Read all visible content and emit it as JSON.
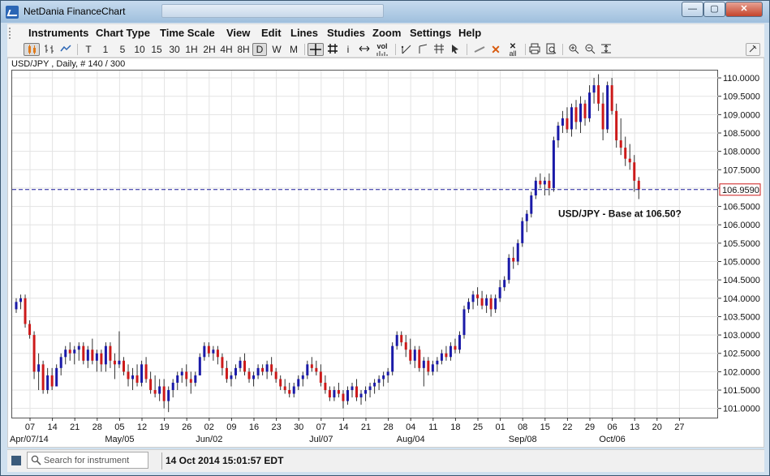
{
  "window": {
    "title": "NetDania FinanceChart",
    "title_search_value": "",
    "buttons": {
      "minimize": "—",
      "maximize": "▢",
      "close": "✕"
    }
  },
  "menu": {
    "items": [
      "Instruments",
      "Chart Type",
      "Time Scale",
      "View",
      "Edit",
      "Lines",
      "Studies",
      "Zoom",
      "Settings",
      "Help"
    ]
  },
  "toolbar": {
    "timeframes": [
      "T",
      "1",
      "5",
      "10",
      "15",
      "30",
      "1H",
      "2H",
      "4H",
      "8H",
      "D",
      "W",
      "M"
    ],
    "active_timeframe": "D",
    "info_label": "i",
    "volume_label": "vol",
    "clear_all_label": "all"
  },
  "chart": {
    "symbol_label": "USD/JPY , Daily, # 140 / 300",
    "annotation": "USD/JPY - Base at 106.50?",
    "current_price_label": "106.9590",
    "colors": {
      "up": "#1a1aa8",
      "down": "#cc1a1a",
      "price_line": "#1d1d9c",
      "price_box_border": "#cc1a1a",
      "grid": "#e3e3e3"
    }
  },
  "status": {
    "search_placeholder": "Search for instrument",
    "datetime": "14 Oct 2014 15:01:57 EDT"
  },
  "chart_data": {
    "type": "candlestick",
    "title": "USD/JPY , Daily, # 140 / 300",
    "ylim": [
      100.75,
      110.2
    ],
    "y_ticks": [
      101.0,
      101.5,
      102.0,
      102.5,
      103.0,
      103.5,
      104.0,
      104.5,
      105.0,
      105.5,
      106.0,
      106.5,
      107.0,
      107.5,
      108.0,
      108.5,
      109.0,
      109.5,
      110.0
    ],
    "y_tick_labels": [
      "101.0000",
      "101.5000",
      "102.0000",
      "102.5000",
      "103.0000",
      "103.5000",
      "104.0000",
      "104.5000",
      "105.0000",
      "105.5000",
      "106.0000",
      "106.5000",
      "107.0000",
      "107.5000",
      "108.0000",
      "108.5000",
      "109.0000",
      "109.5000",
      "110.0000"
    ],
    "x_tick_labels": [
      "07",
      "14",
      "21",
      "28",
      "05",
      "12",
      "19",
      "26",
      "02",
      "09",
      "16",
      "23",
      "30",
      "07",
      "14",
      "21",
      "28",
      "04",
      "11",
      "18",
      "25",
      "01",
      "08",
      "15",
      "22",
      "29",
      "06",
      "13",
      "20",
      "27"
    ],
    "month_labels": [
      {
        "label": "Apr/07/14",
        "index": 0
      },
      {
        "label": "May/05",
        "index": 4
      },
      {
        "label": "Jun/02",
        "index": 8
      },
      {
        "label": "Jul/07",
        "index": 13
      },
      {
        "label": "Aug/04",
        "index": 17
      },
      {
        "label": "Sep/08",
        "index": 22
      },
      {
        "label": "Oct/06",
        "index": 26
      }
    ],
    "current_price": 106.959,
    "grid": true,
    "candles": [
      [
        103.7,
        104.0,
        103.6,
        103.9
      ],
      [
        103.9,
        104.1,
        103.7,
        104.0
      ],
      [
        104.0,
        104.1,
        103.2,
        103.3
      ],
      [
        103.3,
        103.4,
        102.9,
        103.0
      ],
      [
        103.0,
        103.1,
        101.8,
        102.0
      ],
      [
        102.0,
        102.5,
        101.5,
        102.2
      ],
      [
        102.2,
        102.3,
        101.4,
        101.5
      ],
      [
        101.5,
        102.1,
        101.4,
        101.9
      ],
      [
        101.9,
        102.1,
        101.5,
        101.6
      ],
      [
        101.6,
        102.2,
        101.6,
        102.1
      ],
      [
        102.1,
        102.5,
        101.9,
        102.4
      ],
      [
        102.4,
        102.7,
        102.2,
        102.6
      ],
      [
        102.6,
        102.8,
        102.3,
        102.5
      ],
      [
        102.5,
        102.7,
        102.2,
        102.6
      ],
      [
        102.6,
        102.8,
        102.3,
        102.7
      ],
      [
        102.7,
        102.8,
        102.2,
        102.3
      ],
      [
        102.3,
        102.7,
        102.1,
        102.6
      ],
      [
        102.6,
        102.9,
        102.2,
        102.3
      ],
      [
        102.3,
        102.6,
        102.0,
        102.5
      ],
      [
        102.5,
        102.6,
        102.0,
        102.2
      ],
      [
        102.2,
        102.8,
        102.0,
        102.7
      ],
      [
        102.7,
        102.8,
        102.1,
        102.3
      ],
      [
        102.3,
        102.5,
        101.8,
        102.2
      ],
      [
        102.2,
        103.1,
        102.1,
        102.3
      ],
      [
        102.3,
        102.4,
        101.9,
        102.0
      ],
      [
        102.0,
        102.2,
        101.6,
        101.8
      ],
      [
        101.8,
        102.1,
        101.5,
        101.9
      ],
      [
        101.9,
        102.2,
        101.6,
        101.7
      ],
      [
        101.7,
        102.3,
        101.6,
        102.2
      ],
      [
        102.2,
        102.4,
        101.7,
        101.8
      ],
      [
        101.8,
        102.0,
        101.4,
        101.5
      ],
      [
        101.5,
        101.9,
        101.3,
        101.4
      ],
      [
        101.4,
        101.8,
        101.2,
        101.6
      ],
      [
        101.6,
        101.8,
        101.0,
        101.2
      ],
      [
        101.2,
        101.6,
        100.9,
        101.5
      ],
      [
        101.5,
        101.8,
        101.3,
        101.7
      ],
      [
        101.7,
        102.0,
        101.5,
        101.9
      ],
      [
        101.9,
        102.1,
        101.7,
        102.0
      ],
      [
        102.0,
        102.2,
        101.6,
        101.8
      ],
      [
        101.8,
        102.0,
        101.4,
        101.7
      ],
      [
        101.7,
        102.0,
        101.6,
        101.9
      ],
      [
        101.9,
        102.5,
        101.9,
        102.4
      ],
      [
        102.4,
        102.8,
        102.3,
        102.7
      ],
      [
        102.7,
        102.8,
        102.4,
        102.5
      ],
      [
        102.5,
        102.7,
        102.3,
        102.6
      ],
      [
        102.6,
        102.7,
        102.2,
        102.4
      ],
      [
        102.4,
        102.5,
        101.9,
        102.1
      ],
      [
        102.1,
        102.3,
        101.7,
        101.8
      ],
      [
        101.8,
        102.0,
        101.6,
        101.9
      ],
      [
        101.9,
        102.2,
        101.8,
        102.1
      ],
      [
        102.1,
        102.4,
        102.0,
        102.3
      ],
      [
        102.3,
        102.5,
        101.9,
        102.0
      ],
      [
        102.0,
        102.1,
        101.7,
        101.8
      ],
      [
        101.8,
        102.0,
        101.6,
        101.9
      ],
      [
        101.9,
        102.2,
        101.8,
        102.1
      ],
      [
        102.1,
        102.2,
        101.9,
        102.0
      ],
      [
        102.0,
        102.3,
        101.8,
        102.2
      ],
      [
        102.2,
        102.4,
        101.9,
        102.0
      ],
      [
        102.0,
        102.1,
        101.7,
        101.8
      ],
      [
        101.8,
        101.9,
        101.5,
        101.6
      ],
      [
        101.6,
        101.8,
        101.4,
        101.5
      ],
      [
        101.5,
        101.7,
        101.3,
        101.4
      ],
      [
        101.4,
        101.7,
        101.3,
        101.6
      ],
      [
        101.6,
        101.9,
        101.5,
        101.8
      ],
      [
        101.8,
        102.0,
        101.6,
        101.9
      ],
      [
        101.9,
        102.3,
        101.8,
        102.2
      ],
      [
        102.2,
        102.4,
        102.0,
        102.1
      ],
      [
        102.1,
        102.3,
        101.9,
        102.0
      ],
      [
        102.0,
        102.2,
        101.6,
        101.7
      ],
      [
        101.7,
        101.9,
        101.4,
        101.5
      ],
      [
        101.5,
        101.6,
        101.2,
        101.3
      ],
      [
        101.3,
        101.6,
        101.2,
        101.5
      ],
      [
        101.5,
        101.7,
        101.3,
        101.4
      ],
      [
        101.4,
        101.5,
        101.0,
        101.2
      ],
      [
        101.2,
        101.6,
        101.1,
        101.5
      ],
      [
        101.5,
        101.7,
        101.3,
        101.6
      ],
      [
        101.6,
        101.8,
        101.2,
        101.3
      ],
      [
        101.3,
        101.5,
        101.1,
        101.4
      ],
      [
        101.4,
        101.6,
        101.2,
        101.5
      ],
      [
        101.5,
        101.7,
        101.3,
        101.6
      ],
      [
        101.6,
        101.8,
        101.4,
        101.7
      ],
      [
        101.7,
        101.9,
        101.5,
        101.8
      ],
      [
        101.8,
        102.0,
        101.6,
        101.9
      ],
      [
        101.9,
        102.1,
        101.7,
        102.0
      ],
      [
        102.0,
        102.8,
        101.9,
        102.7
      ],
      [
        102.7,
        103.1,
        102.6,
        103.0
      ],
      [
        103.0,
        103.1,
        102.7,
        102.8
      ],
      [
        102.8,
        103.0,
        102.4,
        102.6
      ],
      [
        102.6,
        102.9,
        102.2,
        102.3
      ],
      [
        102.3,
        102.7,
        102.1,
        102.6
      ],
      [
        102.6,
        102.7,
        102.0,
        102.1
      ],
      [
        102.1,
        102.4,
        101.6,
        102.3
      ],
      [
        102.3,
        102.4,
        101.9,
        102.0
      ],
      [
        102.0,
        102.3,
        101.9,
        102.2
      ],
      [
        102.2,
        102.4,
        102.0,
        102.3
      ],
      [
        102.3,
        102.6,
        102.2,
        102.5
      ],
      [
        102.5,
        102.7,
        102.3,
        102.4
      ],
      [
        102.4,
        102.8,
        102.3,
        102.7
      ],
      [
        102.7,
        102.9,
        102.5,
        102.6
      ],
      [
        102.6,
        103.1,
        102.5,
        103.0
      ],
      [
        103.0,
        103.8,
        102.9,
        103.7
      ],
      [
        103.7,
        104.0,
        103.6,
        103.9
      ],
      [
        103.9,
        104.2,
        103.7,
        104.1
      ],
      [
        104.1,
        104.3,
        103.8,
        104.0
      ],
      [
        104.0,
        104.2,
        103.7,
        103.8
      ],
      [
        103.8,
        104.1,
        103.6,
        104.0
      ],
      [
        104.0,
        104.1,
        103.5,
        103.7
      ],
      [
        103.7,
        104.1,
        103.6,
        104.0
      ],
      [
        104.0,
        104.5,
        103.9,
        104.3
      ],
      [
        104.3,
        104.6,
        104.2,
        104.5
      ],
      [
        104.5,
        105.2,
        104.4,
        105.1
      ],
      [
        105.1,
        105.4,
        104.8,
        105.0
      ],
      [
        105.0,
        105.6,
        104.9,
        105.5
      ],
      [
        105.5,
        106.2,
        105.4,
        106.1
      ],
      [
        106.1,
        106.4,
        105.8,
        106.3
      ],
      [
        106.3,
        106.9,
        106.2,
        106.8
      ],
      [
        106.8,
        107.3,
        106.7,
        107.2
      ],
      [
        107.2,
        107.4,
        107.0,
        107.1
      ],
      [
        107.1,
        107.3,
        106.8,
        107.2
      ],
      [
        107.2,
        107.4,
        106.8,
        107.0
      ],
      [
        107.0,
        108.4,
        106.9,
        108.3
      ],
      [
        108.3,
        108.8,
        108.1,
        108.7
      ],
      [
        108.7,
        109.1,
        108.5,
        108.9
      ],
      [
        108.9,
        109.2,
        108.5,
        108.6
      ],
      [
        108.6,
        109.3,
        108.4,
        109.2
      ],
      [
        109.2,
        109.4,
        108.6,
        108.8
      ],
      [
        108.8,
        109.5,
        108.5,
        109.3
      ],
      [
        109.3,
        109.4,
        108.7,
        108.9
      ],
      [
        108.9,
        109.8,
        108.8,
        109.6
      ],
      [
        109.6,
        110.0,
        109.3,
        109.8
      ],
      [
        109.8,
        110.1,
        109.1,
        109.3
      ],
      [
        109.3,
        109.6,
        108.3,
        108.6
      ],
      [
        108.6,
        109.9,
        108.5,
        109.8
      ],
      [
        109.8,
        110.0,
        109.0,
        109.1
      ],
      [
        109.1,
        109.3,
        108.1,
        108.3
      ],
      [
        108.3,
        108.9,
        107.9,
        108.1
      ],
      [
        108.1,
        108.4,
        107.6,
        107.8
      ],
      [
        107.8,
        108.2,
        107.5,
        107.7
      ],
      [
        107.7,
        107.9,
        106.9,
        107.2
      ],
      [
        107.2,
        107.3,
        106.7,
        106.959
      ]
    ]
  }
}
